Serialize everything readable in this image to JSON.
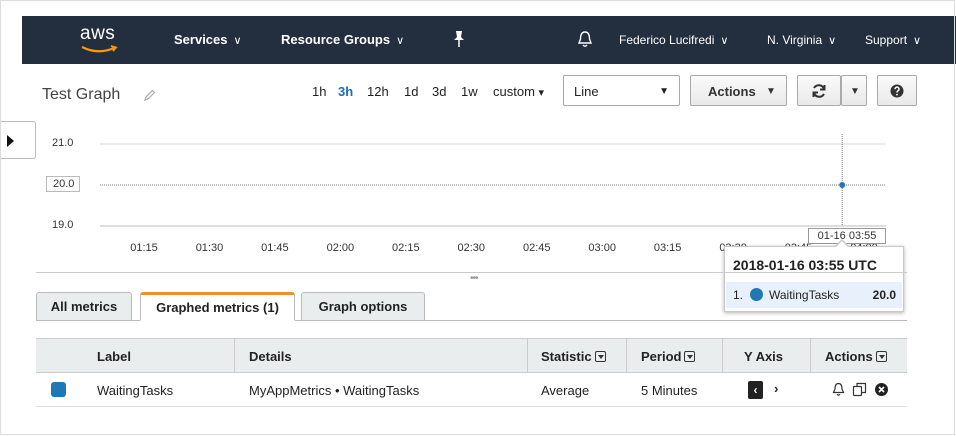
{
  "nav": {
    "logo": "aws",
    "items": [
      {
        "label": "Services",
        "caret": "∨"
      },
      {
        "label": "Resource Groups",
        "caret": "∨"
      }
    ],
    "user": "Federico Lucifredi",
    "region": "N. Virginia",
    "support": "Support",
    "caret": "∨"
  },
  "graph": {
    "title": "Test Graph",
    "ranges": [
      "1h",
      "3h",
      "12h",
      "1d",
      "3d",
      "1w"
    ],
    "active_range": "3h",
    "custom_label": "custom",
    "custom_caret": "▾",
    "type_value": "Line",
    "actions_label": "Actions",
    "dropdown_caret": "▼"
  },
  "chart_data": {
    "type": "line",
    "y_ticks": [
      "21.0",
      "20.0",
      "19.0"
    ],
    "y_highlight": "20.0",
    "x_ticks": [
      "01:15",
      "01:30",
      "01:45",
      "02:00",
      "02:15",
      "02:30",
      "02:45",
      "03:00",
      "03:15",
      "03:30",
      "03:45",
      "04:00"
    ],
    "hover_time_label": "01-16 03:55",
    "ylim": [
      19.0,
      21.0
    ],
    "series": [
      {
        "name": "WaitingTasks",
        "color": "#1f77b4",
        "x": [
          "03:55"
        ],
        "values": [
          20.0
        ]
      }
    ],
    "grid": true
  },
  "tooltip": {
    "title": "2018-01-16 03:55 UTC",
    "index": "1.",
    "metric": "WaitingTasks",
    "value": "20.0"
  },
  "tabs": [
    {
      "label": "All metrics"
    },
    {
      "label": "Graphed metrics (1)"
    },
    {
      "label": "Graph options"
    }
  ],
  "table": {
    "headers": {
      "label": "Label",
      "details": "Details",
      "statistic": "Statistic",
      "period": "Period",
      "y_axis": "Y Axis",
      "actions": "Actions"
    },
    "rows": [
      {
        "color": "#1f77b4",
        "label": "WaitingTasks",
        "details": "MyAppMetrics • WaitingTasks",
        "statistic": "Average",
        "period": "5 Minutes",
        "y_left": "‹",
        "y_right": "›"
      }
    ]
  },
  "colors": {
    "nav_bg": "#232f3e",
    "accent": "#ec912d",
    "link": "#1a6fb5",
    "series": "#1f77b4"
  }
}
